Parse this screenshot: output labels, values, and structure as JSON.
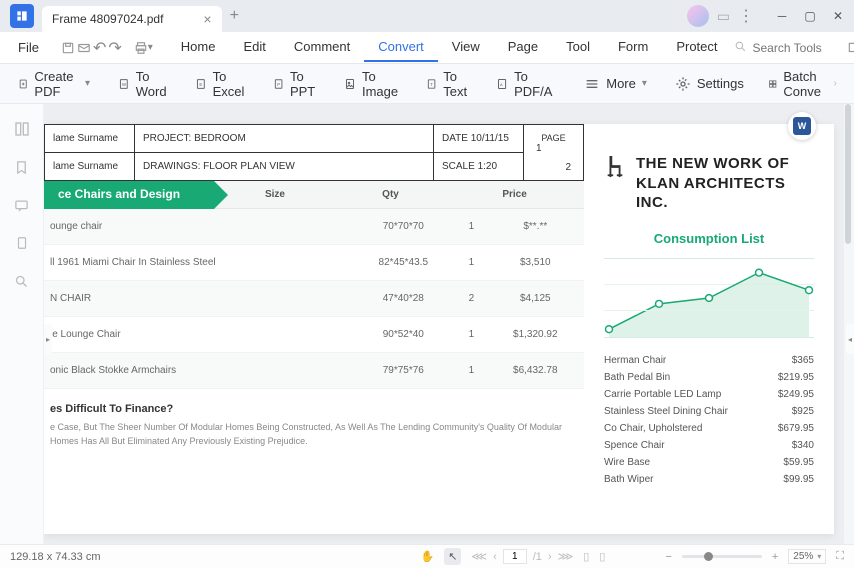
{
  "app": {
    "tab_filename": "Frame 48097024.pdf"
  },
  "menubar": {
    "file": "File",
    "tabs": [
      "Home",
      "Edit",
      "Comment",
      "Convert",
      "View",
      "Page",
      "Tool",
      "Form",
      "Protect"
    ],
    "active_tab": "Convert",
    "search_placeholder": "Search Tools"
  },
  "toolbar": {
    "create": "Create PDF",
    "to_word": "To Word",
    "to_excel": "To Excel",
    "to_ppt": "To PPT",
    "to_image": "To Image",
    "to_text": "To Text",
    "to_pdfa": "To PDF/A",
    "more": "More",
    "settings": "Settings",
    "batch": "Batch Conve"
  },
  "doc": {
    "drawings": {
      "r1c1": "lame Surname",
      "r1c2": "PROJECT: BEDROOM",
      "r1c3": "DATE 10/11/15",
      "r1c4_top": "PAGE",
      "r1c4_num1": "1",
      "r1c4_num2": "2",
      "r2c1": "lame Surname",
      "r2c2": "DRAWINGS: FLOOR PLAN VIEW",
      "r2c3": "SCALE 1:20"
    },
    "heading_chairs": "ce Chairs and Design",
    "table_headers": [
      "Size",
      "Qty",
      "Price"
    ],
    "table_rows": [
      {
        "name": "ounge chair",
        "size": "70*70*70",
        "qty": "1",
        "price": "$**.**"
      },
      {
        "name": "ll 1961 Miami Chair In Stainless Steel",
        "size": "82*45*43.5",
        "qty": "1",
        "price": "$3,510"
      },
      {
        "name": "N CHAIR",
        "size": "47*40*28",
        "qty": "2",
        "price": "$4,125"
      },
      {
        "name": "le Lounge Chair",
        "size": "90*52*40",
        "qty": "1",
        "price": "$1,320.92"
      },
      {
        "name": "onic Black Stokke Armchairs",
        "size": "79*75*76",
        "qty": "1",
        "price": "$6,432.78"
      }
    ],
    "fin_title": "es Difficult To Finance?",
    "fin_text": "e Case, But The Sheer Number Of Modular Homes Being Constructed, As Well As The Lending Community's Quality Of Modular Homes Has All But Eliminated Any Previously Existing Prejudice.",
    "brand_title": "THE NEW WORK OF KLAN ARCHITECTS INC.",
    "consumption": "Consumption List",
    "clist": [
      {
        "name": "Herman Chair",
        "price": "$365"
      },
      {
        "name": "Bath Pedal Bin",
        "price": "$219.95"
      },
      {
        "name": "Carrie Portable LED Lamp",
        "price": "$249.95"
      },
      {
        "name": "Stainless Steel Dining Chair",
        "price": "$925"
      },
      {
        "name": "Co Chair, Upholstered",
        "price": "$679.95"
      },
      {
        "name": "Spence Chair",
        "price": "$340"
      },
      {
        "name": "Wire Base",
        "price": "$59.95"
      },
      {
        "name": "Bath Wiper",
        "price": "$99.95"
      }
    ]
  },
  "status": {
    "dimensions": "129.18 x 74.33 cm",
    "page_current": "1",
    "page_total": "/1",
    "zoom": "25%"
  },
  "chart_data": {
    "type": "line",
    "x": [
      0,
      1,
      2,
      3,
      4
    ],
    "values": [
      10,
      42,
      50,
      82,
      60
    ],
    "ylim": [
      0,
      100
    ]
  }
}
